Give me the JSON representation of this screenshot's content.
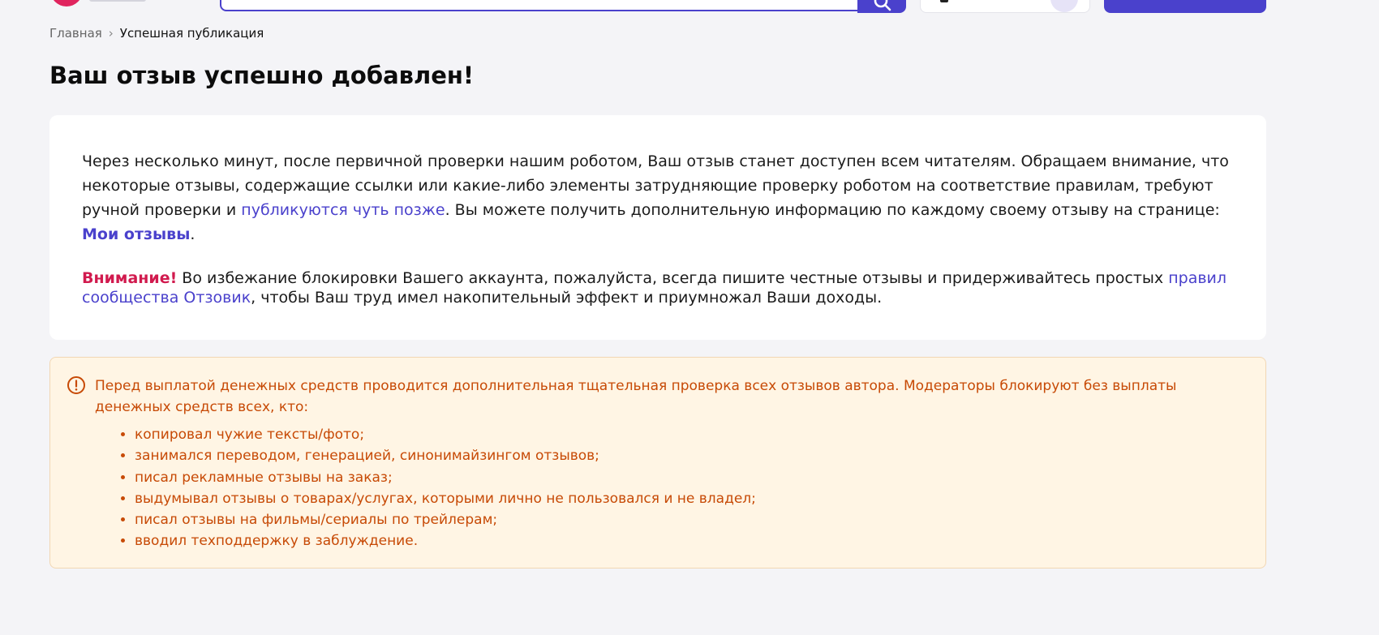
{
  "header": {
    "search_placeholder": ""
  },
  "breadcrumb": {
    "home": "Главная",
    "separator": "›",
    "current": "Успешная публикация"
  },
  "page_title": "Ваш отзыв успешно добавлен!",
  "info": {
    "p1_text": "Через несколько минут, после первичной проверки нашим роботом, Ваш отзыв станет доступен всем читателям. Обращаем внимание, что некоторые отзывы, содержащие ссылки или какие-либо элементы затрудняющие проверку роботом на соответствие правилам, требуют ручной проверки и ",
    "p1_link": "публикуются чуть позже",
    "p1_after": ". Вы можете получить дополнительную информацию по каждому своему отзыву на странице: ",
    "my_reviews_link": "Мои отзывы",
    "p1_end": ".",
    "attention_label": "Внимание!",
    "attention_text": " Во избежание блокировки Вашего аккаунта, пожалуйста, всегда пишите честные отзывы и придерживайтесь простых ",
    "rules_link": "правил сообщества Отзовик",
    "attention_after": ", чтобы Ваш труд имел накопительный эффект и приумножал Ваши доходы."
  },
  "warning": {
    "icon": "exclamation-circle-icon",
    "text": "Перед выплатой денежных средств проводится дополнительная тщательная проверка всех отзывов автора. Модераторы блокируют без выплаты денежных средств всех, кто:",
    "items": [
      "копировал чужие тексты/фото;",
      "занимался переводом, генерацией, синонимайзингом отзывов;",
      "писал рекламные отзывы на заказ;",
      "выдумывал отзывы о товарах/услугах, которыми лично не пользовался и не владел;",
      "писал отзывы на фильмы/сериалы по трейлерам;",
      "вводил техподдержку в заблуждение."
    ]
  },
  "colors": {
    "accent": "#4a41cc",
    "attention": "#d11a4e",
    "warning_text": "#c74a06",
    "warning_bg": "#fff5e4"
  }
}
